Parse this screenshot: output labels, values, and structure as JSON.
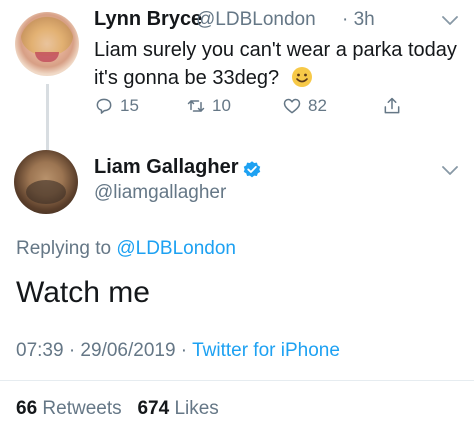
{
  "reply_tweet": {
    "author": {
      "name": "Lynn Bryce",
      "handle": "@LDBLondon",
      "time": "· 3h"
    },
    "text": "Liam surely you can't wear a parka today it's gonna be 33deg?",
    "emoji": "smiley-face",
    "actions": {
      "replies": "15",
      "retweets": "10",
      "likes": "82"
    }
  },
  "main_tweet": {
    "author": {
      "name": "Liam Gallagher",
      "handle": "@liamgallagher",
      "verified": true
    },
    "replying_to_prefix": "Replying to",
    "replying_to_handle": "@LDBLondon",
    "text": "Watch me",
    "timestamp": "07:39 · 29/06/2019 ·",
    "source": "Twitter for iPhone",
    "stats": {
      "retweets_count": "66",
      "retweets_label": "Retweets",
      "likes_count": "674",
      "likes_label": "Likes"
    }
  },
  "colors": {
    "accent": "#1da1f2",
    "muted": "#657786",
    "text": "#14171a",
    "thread_line": "#d8dde1"
  }
}
